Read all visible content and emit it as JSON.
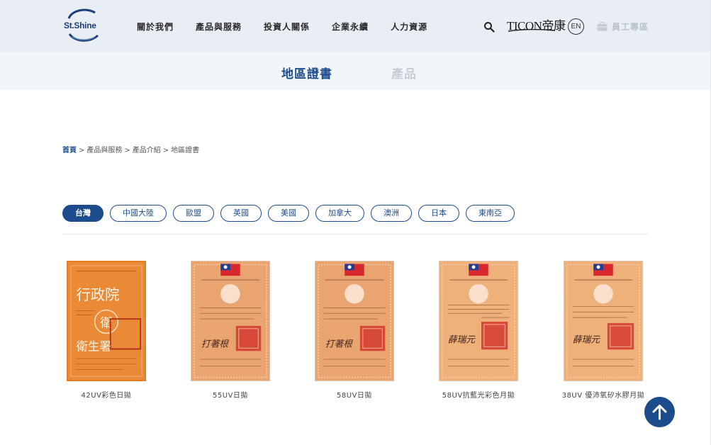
{
  "brand": {
    "logo_text": "St.Shine",
    "partner_logo_text": "TICON帝康"
  },
  "nav": {
    "items": [
      "關於我們",
      "產品與服務",
      "投資人關係",
      "企業永續",
      "人力資源"
    ]
  },
  "header": {
    "language_button": "EN",
    "staff_label": "員工專區",
    "search_icon": "search-icon"
  },
  "subnav": {
    "active_tab": "地區證書",
    "other_tab": "產品"
  },
  "breadcrumb": {
    "home": "首頁",
    "sep": ">",
    "level2": "產品與服務",
    "level3": "產品介紹",
    "current": "地區證書"
  },
  "filters": {
    "items": [
      "台灣",
      "中國大陸",
      "歐盟",
      "英國",
      "美國",
      "加拿大",
      "澳洲",
      "日本",
      "東南亞"
    ],
    "active": "台灣"
  },
  "products": [
    {
      "title": "42UV彩色日拋",
      "style": "orange"
    },
    {
      "title": "55UV日拋",
      "style": "flag"
    },
    {
      "title": "58UV日拋",
      "style": "flag"
    },
    {
      "title": "58UV抗藍光彩色月拋",
      "style": "flag"
    },
    {
      "title": "38UV 優沛氧矽水膠月拋",
      "style": "flag"
    }
  ],
  "certificate_text": {
    "agency": "行政院",
    "seal_char": "衛",
    "sig_1": "衛生署",
    "sig_2": "打著根",
    "sig_3": "薛瑞元"
  },
  "colors": {
    "brand_blue": "#1d4c8c",
    "header_bg": "#e9eef5",
    "subnav_bg": "#f3f6f9",
    "cert_orange": "#ea8a36",
    "cert_peach": "#e9a46f",
    "flag_red": "#d8282f"
  },
  "scroll_top": {
    "icon": "arrow-up-icon"
  }
}
